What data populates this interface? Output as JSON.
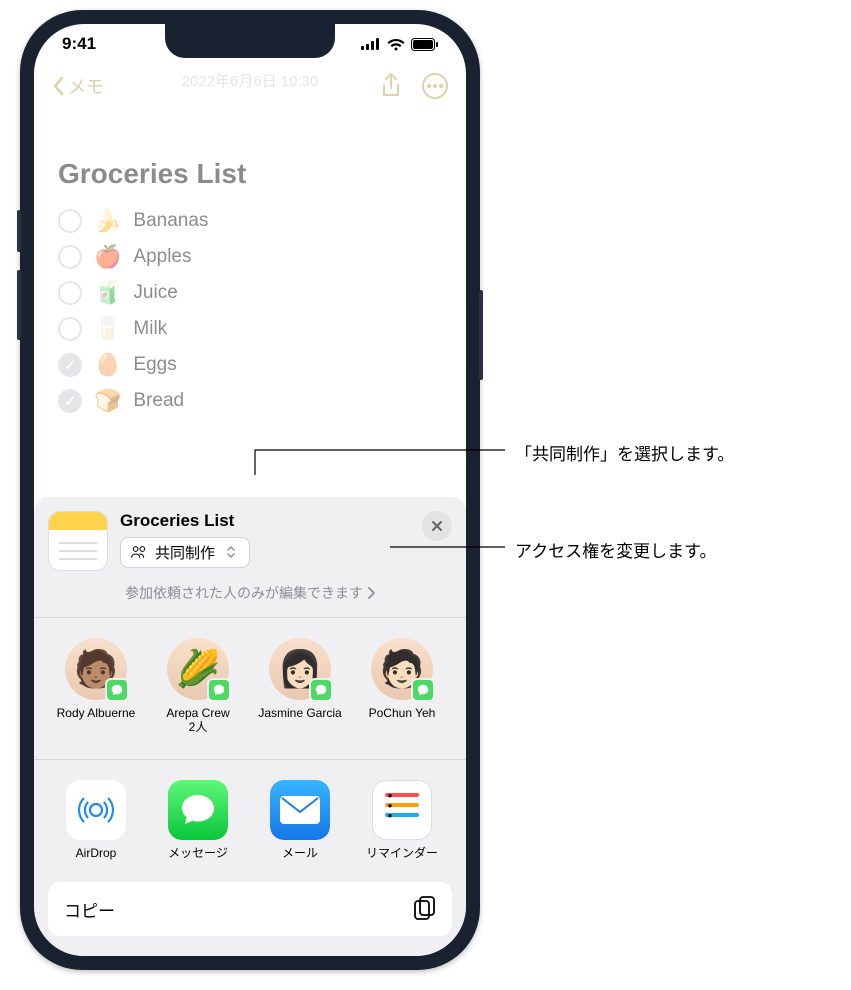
{
  "status": {
    "time": "9:41"
  },
  "nav": {
    "back_label": "メモ",
    "date": "2022年6月6日 10:30"
  },
  "note": {
    "title": "Groceries List",
    "items": [
      {
        "emoji": "🍌",
        "label": "Bananas",
        "checked": false
      },
      {
        "emoji": "🍎",
        "label": "Apples",
        "checked": false
      },
      {
        "emoji": "🧃",
        "label": "Juice",
        "checked": false
      },
      {
        "emoji": "🥛",
        "label": "Milk",
        "checked": false
      },
      {
        "emoji": "🥚",
        "label": "Eggs",
        "checked": true
      },
      {
        "emoji": "🍞",
        "label": "Bread",
        "checked": true
      }
    ]
  },
  "sheet": {
    "title": "Groceries List",
    "mode_label": "共同制作",
    "access_label": "参加依頼された人のみが編集できます",
    "contacts": [
      {
        "name": "Rody Albuerne",
        "sub": "",
        "avatar": "🧑🏽"
      },
      {
        "name": "Arepa Crew",
        "sub": "2人",
        "avatar": "🌽"
      },
      {
        "name": "Jasmine Garcia",
        "sub": "",
        "avatar": "👩🏻"
      },
      {
        "name": "PoChun Yeh",
        "sub": "",
        "avatar": "🧑🏻"
      }
    ],
    "apps": [
      {
        "name": "AirDrop",
        "icon": "airdrop"
      },
      {
        "name": "メッセージ",
        "icon": "messages"
      },
      {
        "name": "メール",
        "icon": "mail"
      },
      {
        "name": "リマインダー",
        "icon": "reminders"
      }
    ],
    "copy_label": "コピー"
  },
  "callouts": {
    "collab": "「共同制作」を選択します。",
    "access": "アクセス権を変更します。"
  }
}
